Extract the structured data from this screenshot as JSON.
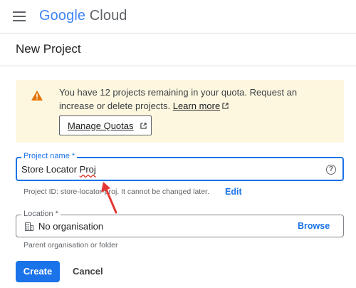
{
  "header": {
    "logo_google": "Google",
    "logo_cloud": "Cloud"
  },
  "page": {
    "title": "New Project"
  },
  "alert": {
    "message": "You have 12 projects remaining in your quota. Request an increase or delete projects.",
    "learn_more": "Learn more",
    "manage_quotas": "Manage Quotas"
  },
  "project_name": {
    "label": "Project name *",
    "value_prefix": "Store Locator ",
    "value_misspelled": "Proj",
    "project_id_hint": "Project ID: store-locator-proj. It cannot be changed later.",
    "edit_label": "Edit"
  },
  "location": {
    "label": "Location *",
    "value": "No organisation",
    "browse_label": "Browse",
    "hint": "Parent organisation or folder"
  },
  "actions": {
    "create_label": "Create",
    "cancel_label": "Cancel"
  },
  "colors": {
    "accent": "#1a73e8",
    "alert_bg": "#fef7e0",
    "warning": "#e37400",
    "annotation_arrow": "#e53935"
  }
}
